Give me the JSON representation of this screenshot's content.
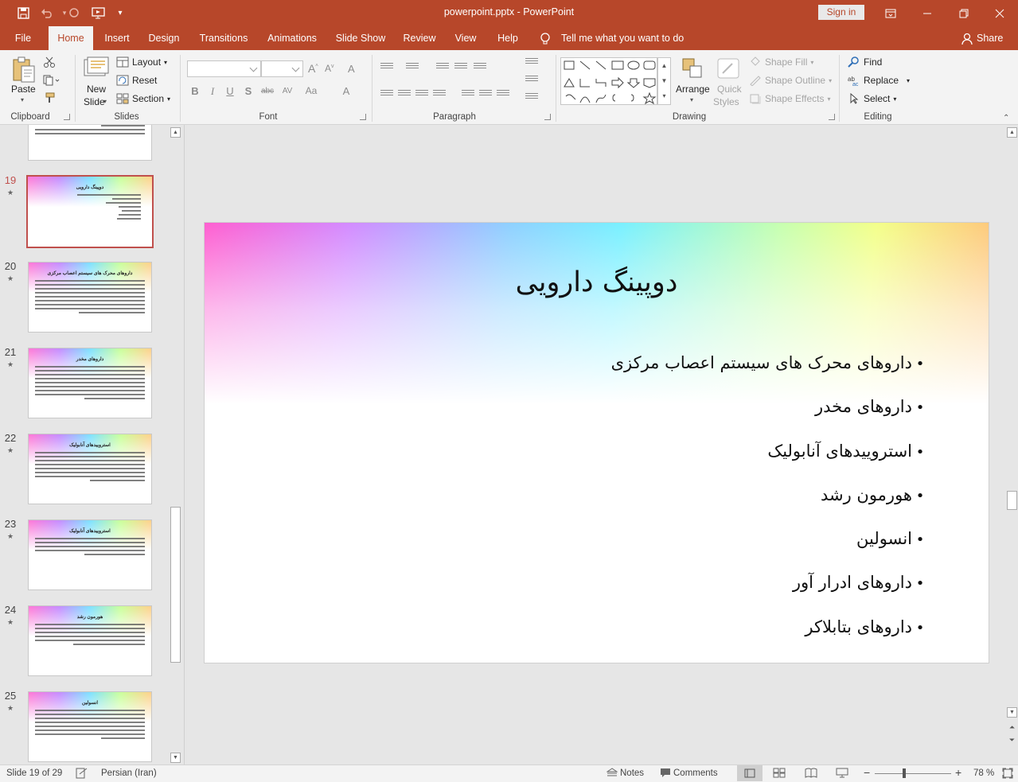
{
  "titlebar": {
    "doc_title": "powerpoint.pptx  -  PowerPoint",
    "signin": "Sign in"
  },
  "tabs": [
    "File",
    "Home",
    "Insert",
    "Design",
    "Transitions",
    "Animations",
    "Slide Show",
    "Review",
    "View",
    "Help"
  ],
  "active_tab": "Home",
  "tell_me": "Tell me what you want to do",
  "share": "Share",
  "ribbon": {
    "clipboard": {
      "paste": "Paste",
      "label": "Clipboard"
    },
    "slides": {
      "new_slide_1": "New",
      "new_slide_2": "Slide",
      "layout": "Layout",
      "reset": "Reset",
      "section": "Section",
      "label": "Slides"
    },
    "font": {
      "label": "Font"
    },
    "paragraph": {
      "label": "Paragraph"
    },
    "drawing": {
      "arrange": "Arrange",
      "quick_styles_1": "Quick",
      "quick_styles_2": "Styles",
      "shape_fill": "Shape Fill",
      "shape_outline": "Shape Outline",
      "shape_effects": "Shape Effects",
      "label": "Drawing"
    },
    "editing": {
      "find": "Find",
      "replace": "Replace",
      "select": "Select",
      "label": "Editing"
    }
  },
  "thumbnails": [
    {
      "num": "19",
      "title": "دوپینگ دارویی",
      "selected": true
    },
    {
      "num": "20",
      "title": "داروهای محرک های سیستم اعصاب مرکزی",
      "selected": false
    },
    {
      "num": "21",
      "title": "داروهای مخدر",
      "selected": false
    },
    {
      "num": "22",
      "title": "استروییدهای آنابولیک",
      "selected": false
    },
    {
      "num": "23",
      "title": "استروییدهای آنابولیک",
      "selected": false
    },
    {
      "num": "24",
      "title": "هورمون رشد",
      "selected": false
    },
    {
      "num": "25",
      "title": "انسولین",
      "selected": false
    }
  ],
  "slide": {
    "title": "دوپینگ دارویی",
    "bullets": [
      "داروهای محرک های سیستم اعصاب مرکزی",
      "داروهای مخدر",
      "استروییدهای آنابولیک",
      "هورمون رشد",
      "انسولین",
      "داروهای ادرار آور",
      "داروهای بتابلاکر"
    ]
  },
  "status": {
    "slide_info": "Slide 19 of 29",
    "language": "Persian (Iran)",
    "notes": "Notes",
    "comments": "Comments",
    "zoom": "78 %"
  },
  "colors": {
    "accent": "#b7472a",
    "selection": "#c0504d"
  }
}
